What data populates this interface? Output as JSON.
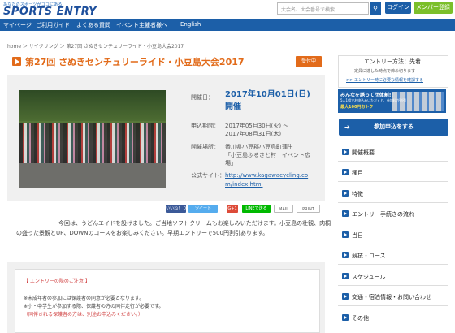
{
  "header": {
    "tagline": "あなたのスポーツがココにある",
    "logo": "SPORTS ENTRY",
    "search_placeholder": "大会名、大会番号で検索",
    "login_label": "ログイン",
    "member_label": "メンバー登録"
  },
  "nav": {
    "items": [
      "マイページ",
      "ご利用ガイド",
      "よくある質問",
      "イベント主催者様へ",
      "English"
    ]
  },
  "breadcrumb": "home ＞ サイクリング ＞ 第27回 さぬきセンチュリーライド・小豆島大会2017",
  "event": {
    "title": "第27回 さぬきセンチュリーライド・小豆島大会2017",
    "status": "受付中",
    "date_label": "開催日：",
    "date_value": "2017年10月01日(日)開催",
    "period_label": "申込期間：",
    "period_line1": "2017年05月30日(火) ～",
    "period_line2": "2017年08月31日(木)",
    "place_label": "開催場所：",
    "place_line1": "香川県小豆郡小豆島町蒲生",
    "place_line2": "「小豆島ふるさと村　イベント広",
    "place_line3": "場」",
    "site_label": "公式サイト：",
    "site_line1": "http://www.kagawacycling.co",
    "site_line2": "m/index.html"
  },
  "share": {
    "like": "いいね！ 0",
    "tweet": "ツイート",
    "gplus": "G+1",
    "line": "LINEで送る",
    "mail": "MAIL",
    "print": "PRINT"
  },
  "description": {
    "line1": "今回は、うどんエイドを設けました。ご当地ソフトクリームもお楽しみいただけます。小豆島の壮観、肉桐",
    "line2": "の盛った景観とUP、DOWNのコースをお楽しみください。早期エントリーで500円割引あります。"
  },
  "notice": {
    "title": "【 エントリーの際のご注意 】",
    "line1": "※未成年者の参加には保護者の同意が必要となります。",
    "line2": "※小・中学生が参加する際、保護者の方の同伴走行が必要です。",
    "line3": "（同伴される保護者の方は、別途お申込みください。）"
  },
  "sidebar": {
    "entry_title": "エントリー方法：先着",
    "entry_sub": "定員に達した時点で締め切ります",
    "entry_link": ">> エントリー時に必要な情報を確認する",
    "banner_title": "みんなを誘って団体割!!",
    "banner_sub": "5人1組でお申込みいただくと、参加料が割引",
    "banner_price": "最大100円おトク",
    "apply_label": "参加申込をする",
    "apply_icon": "arrow-circle-icon",
    "menu": [
      "開催概要",
      "種目",
      "特徴",
      "エントリー手続きの流れ",
      "当日",
      "競技・コース",
      "スケジュール",
      "交通・宿泊情報・お問い合わせ",
      "その他"
    ]
  },
  "colors": {
    "brand_blue": "#1c5fa8",
    "accent_orange": "#e26b1a",
    "member_green": "#7bbf2a"
  }
}
